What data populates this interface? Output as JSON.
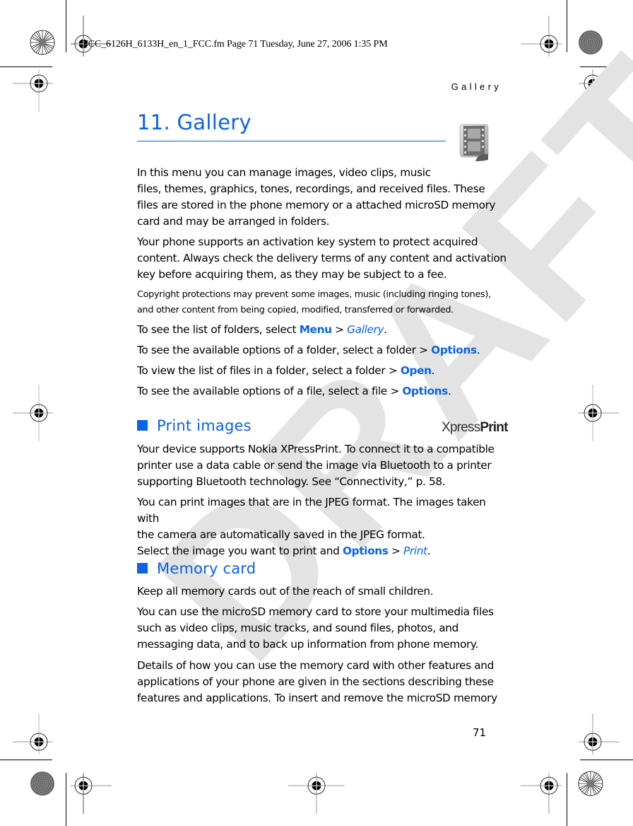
{
  "slug": {
    "text": "FCC_6126H_6133H_en_1_FCC.fm  Page 71  Tuesday, June 27, 2006  1:35 PM"
  },
  "running_header": "Gallery",
  "watermark": "DRAFT",
  "chapter": {
    "title": "11. Gallery",
    "icon": "film-gallery-icon"
  },
  "intro": {
    "p1_line1": "In this menu you can manage images, video clips, music",
    "p1_rest": "files, themes, graphics, tones, recordings, and received files. These files are stored in the phone memory or a attached microSD memory card and may be arranged in folders.",
    "p2": "Your phone supports an activation key system to protect acquired content. Always check the delivery terms of any content and activation key before acquiring them, as they may be subject to a fee.",
    "note": "Copyright protections may prevent some images, music (including ringing tones), and other content from being copied, modified, transferred or forwarded."
  },
  "instructions": [
    {
      "pre": "To see the list of folders, select ",
      "kw": "Menu",
      "sep": " > ",
      "it": "Gallery",
      "post": "."
    },
    {
      "pre": "To see the available options of a folder, select a folder > ",
      "kw": "Options",
      "post": "."
    },
    {
      "pre": "To view the list of files in a folder, select a folder > ",
      "kw": "Open",
      "post": "."
    },
    {
      "pre": "To see the available options of a file, select a file > ",
      "kw": "Options",
      "post": "."
    }
  ],
  "print_images": {
    "heading": "Print images",
    "logo_light": "Xpress",
    "logo_bold": "Print",
    "p1": "Your device supports Nokia XPressPrint. To connect it to a compatible printer use a data cable or send the image via Bluetooth to a printer supporting Bluetooth technology. See “Connectivity,” p. 58.",
    "p2_line1": "You can print images that are in the JPEG format. The images taken with",
    "p2_line2": "the camera are automatically saved in the JPEG format.",
    "p2_line3_pre": "Select the image you want to print and ",
    "p2_line3_kw": "Options",
    "p2_line3_sep": " > ",
    "p2_line3_it": "Print",
    "p2_line3_post": "."
  },
  "memory_card": {
    "heading": "Memory card",
    "p1": "Keep all memory cards out of the reach of small children.",
    "p2": "You can use the microSD memory card to store your multimedia files such as video clips, music tracks, and sound files, photos, and messaging data, and to back up information from phone memory.",
    "p3": "Details of how you can use the memory card with other features and applications of your phone are given in the sections describing these features and applications. To insert and remove the microSD memory"
  },
  "page_number": "71"
}
